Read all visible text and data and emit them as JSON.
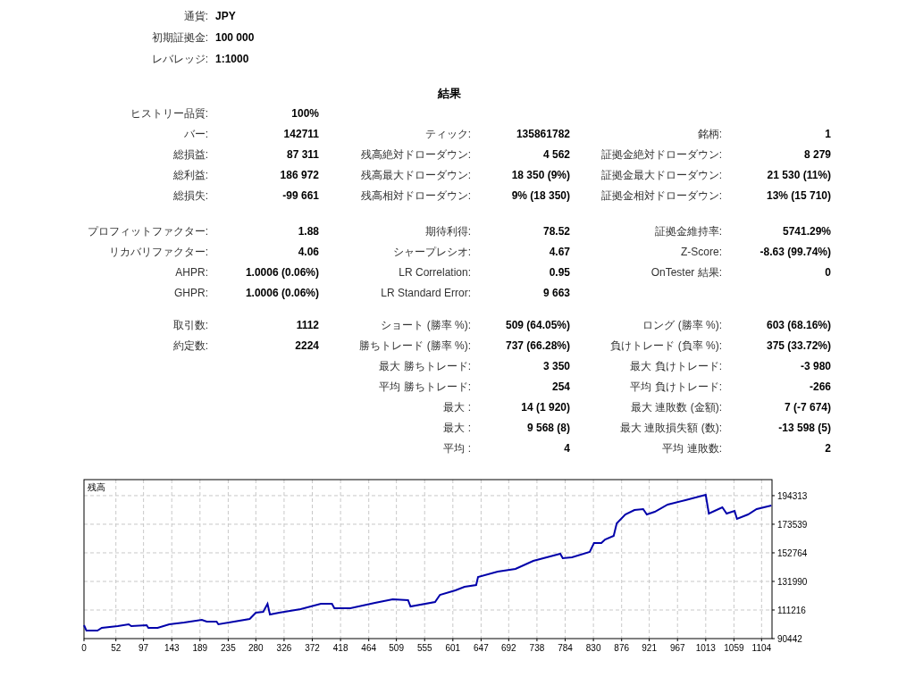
{
  "header": [
    {
      "label": "通貨:",
      "value": "JPY"
    },
    {
      "label": "初期証拠金:",
      "value": "100 000"
    },
    {
      "label": "レバレッジ:",
      "value": "1:1000"
    }
  ],
  "title": "結果",
  "sections": [
    {
      "rows": [
        {
          "left": {
            "label": "ヒストリー品質:",
            "value": "100%"
          }
        },
        {
          "left": {
            "label": "バー:",
            "value": "142711"
          },
          "middle": {
            "label": "ティック:",
            "value": "135861782"
          },
          "right": {
            "label": "銘柄:",
            "value": "1"
          }
        },
        {
          "left": {
            "label": "総損益:",
            "value": "87 311"
          },
          "middle": {
            "label": "残高絶対ドローダウン:",
            "value": "4 562"
          },
          "right": {
            "label": "証拠金絶対ドローダウン:",
            "value": "8 279"
          }
        },
        {
          "left": {
            "label": "総利益:",
            "value": "186 972"
          },
          "middle": {
            "label": "残高最大ドローダウン:",
            "value": "18 350 (9%)"
          },
          "right": {
            "label": "証拠金最大ドローダウン:",
            "value": "21 530 (11%)"
          }
        },
        {
          "left": {
            "label": "総損失:",
            "value": "-99 661"
          },
          "middle": {
            "label": "残高相対ドローダウン:",
            "value": "9% (18 350)"
          },
          "right": {
            "label": "証拠金相対ドローダウン:",
            "value": "13% (15 710)"
          }
        }
      ]
    },
    {
      "rows": [
        {
          "left": {
            "label": "プロフィットファクター:",
            "value": "1.88"
          },
          "middle": {
            "label": "期待利得:",
            "value": "78.52"
          },
          "right": {
            "label": "証拠金維持率:",
            "value": "5741.29%"
          }
        },
        {
          "left": {
            "label": "リカバリファクター:",
            "value": "4.06"
          },
          "middle": {
            "label": "シャープレシオ:",
            "value": "4.67"
          },
          "right": {
            "label": "Z-Score:",
            "value": "-8.63 (99.74%)"
          }
        },
        {
          "left": {
            "label": "AHPR:",
            "value": "1.0006 (0.06%)"
          },
          "middle": {
            "label": "LR Correlation:",
            "value": "0.95"
          },
          "right": {
            "label": "OnTester 結果:",
            "value": "0"
          }
        },
        {
          "left": {
            "label": "GHPR:",
            "value": "1.0006 (0.06%)"
          },
          "middle": {
            "label": "LR Standard Error:",
            "value": "9 663"
          }
        }
      ]
    },
    {
      "rows": [
        {
          "left": {
            "label": "取引数:",
            "value": "1112"
          },
          "middle": {
            "label": "ショート (勝率 %):",
            "value": "509 (64.05%)"
          },
          "right": {
            "label": "ロング (勝率 %):",
            "value": "603 (68.16%)"
          }
        },
        {
          "left": {
            "label": "約定数:",
            "value": "2224"
          },
          "middle": {
            "label": "勝ちトレード (勝率 %):",
            "value": "737 (66.28%)"
          },
          "right": {
            "label": "負けトレード (負率 %):",
            "value": "375 (33.72%)"
          }
        },
        {
          "middle": {
            "label": "最大 勝ちトレード:",
            "value": "3 350"
          },
          "right": {
            "label": "最大 負けトレード:",
            "value": "-3 980"
          }
        },
        {
          "middle": {
            "label": "平均 勝ちトレード:",
            "value": "254"
          },
          "right": {
            "label": "平均 負けトレード:",
            "value": "-266"
          }
        },
        {
          "middle": {
            "label": "最大 :",
            "value": "14 (1 920)"
          },
          "right": {
            "label": "最大 連敗数 (金額):",
            "value": "7 (-7 674)"
          }
        },
        {
          "middle": {
            "label": "最大 :",
            "value": "9 568 (8)"
          },
          "right": {
            "label": "最大 連敗損失額 (数):",
            "value": "-13 598 (5)"
          }
        },
        {
          "middle": {
            "label": "平均 :",
            "value": "4"
          },
          "right": {
            "label": "平均 連敗数:",
            "value": "2"
          }
        }
      ]
    }
  ],
  "chart": {
    "chart_data": {
      "type": "line",
      "grid": true,
      "xlim": [
        0,
        1121
      ],
      "ylim": [
        90442,
        205964
      ],
      "xticks": [
        0,
        52,
        97,
        143,
        189,
        235,
        280,
        326,
        372,
        418,
        464,
        509,
        555,
        601,
        647,
        692,
        738,
        784,
        830,
        876,
        921,
        967,
        1013,
        1059,
        1104
      ],
      "yticks": [
        90442,
        111216,
        131990,
        152764,
        173539,
        194313
      ],
      "x": [
        0,
        4,
        22,
        29,
        55,
        73,
        77,
        102,
        105,
        120,
        139,
        163,
        192,
        200,
        216,
        219,
        236,
        270,
        280,
        292,
        299,
        303,
        318,
        353,
        386,
        404,
        408,
        434,
        474,
        503,
        528,
        532,
        572,
        580,
        605,
        620,
        639,
        642,
        674,
        703,
        732,
        765,
        776,
        780,
        795,
        824,
        831,
        843,
        849,
        863,
        868,
        882,
        897,
        911,
        917,
        930,
        951,
        980,
        1013,
        1018,
        1040,
        1047,
        1060,
        1064,
        1082,
        1096,
        1120
      ],
      "series": [
        {
          "name": "残高",
          "color": "#0000aa",
          "values": [
            100177,
            96283,
            96283,
            98230,
            99528,
            100826,
            99528,
            100177,
            98230,
            98230,
            100826,
            102124,
            104071,
            102773,
            102773,
            100826,
            102124,
            104720,
            109263,
            109912,
            115753,
            107965,
            109263,
            111859,
            115753,
            115753,
            112508,
            112508,
            116402,
            118998,
            118349,
            113806,
            117051,
            122243,
            125488,
            128084,
            129382,
            135223,
            139117,
            141064,
            146905,
            150799,
            152097,
            148852,
            149501,
            153395,
            159885,
            159885,
            162481,
            165077,
            174163,
            180653,
            183898,
            184547,
            180653,
            182600,
            187792,
            191037,
            194931,
            181302,
            185845,
            181302,
            183249,
            177408,
            180653,
            184547,
            187143
          ]
        }
      ]
    }
  }
}
